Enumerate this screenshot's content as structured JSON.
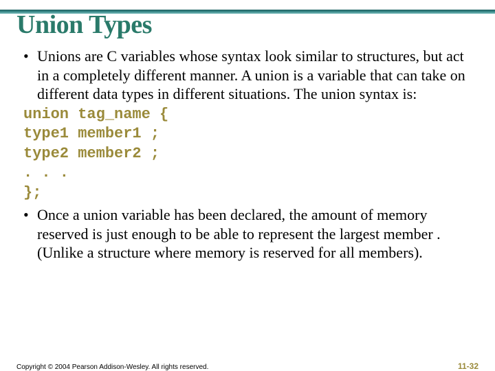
{
  "title": "Union Types",
  "bullets": {
    "b1": "Unions are C variables whose syntax look similar to structures, but act in a completely different manner. A union is a variable that can take on different data types in different situations. The union syntax is:",
    "b2": "Once a union variable has been declared, the amount of memory reserved is just enough to be able to represent the largest member . (Unlike a structure where memory is reserved for all members)."
  },
  "code": {
    "l1": "union tag_name {",
    "l2": "type1 member1 ;",
    "l3": "type2 member2 ;",
    "l4": ". . .",
    "l5": "};"
  },
  "footer": {
    "copyright": "Copyright © 2004 Pearson Addison-Wesley. All rights reserved.",
    "pagenum": "11-32"
  },
  "bullet_char": "•"
}
